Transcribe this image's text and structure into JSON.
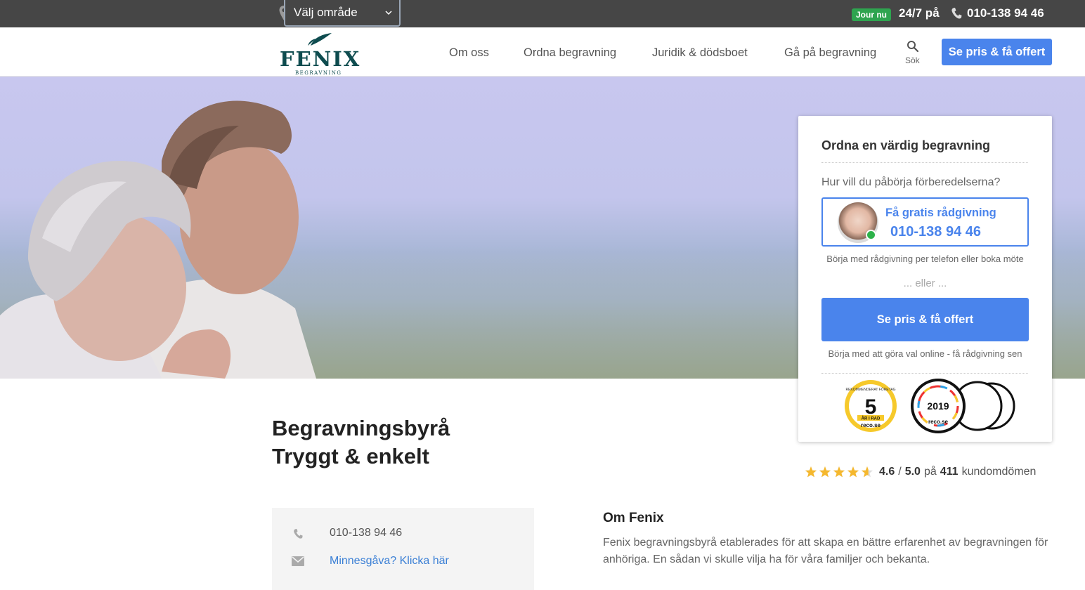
{
  "topbar": {
    "region_label": "Välj område",
    "jour_badge": "Jour nu",
    "hours": "24/7 på",
    "phone": "010-138 94 46"
  },
  "header": {
    "logo_text": "FENIX",
    "logo_subtext": "BEGRAVNING",
    "nav": [
      "Om oss",
      "Ordna begravning",
      "Juridik & dödsboet",
      "Gå på begravning"
    ],
    "search_label": "Sök",
    "cta": "Se pris & få offert"
  },
  "card": {
    "title": "Ordna en värdig begravning",
    "question": "Hur vill du påbörja förberedelserna?",
    "advice_label": "Få gratis rådgivning",
    "advice_phone": "010-138 94 46",
    "note_phone": "Börja med rådgivning per telefon eller boka möte",
    "or": "... eller ...",
    "cta": "Se pris & få offert",
    "note_online": "Börja med att göra val online - få rådgivning sen",
    "badge_years": "5",
    "badge_years_ribbon": "ÅR I RAD",
    "badge_years_ring": "REKOMMENDERAT FÖRETAG",
    "badge_year": "2019",
    "badge_brand": "reco.se"
  },
  "main": {
    "heading_line1": "Begravningsbyrå",
    "heading_line2": "Tryggt & enkelt",
    "rating_value": "4.6",
    "rating_sep": "/",
    "rating_max": "5.0",
    "rating_pa": "på",
    "rating_count": "411",
    "rating_suffix": "kundomdömen",
    "stars_fraction": 0.92
  },
  "contact": {
    "phone": "010-138 94 46",
    "memorial_link": "Minnesgåva? Klicka här"
  },
  "about": {
    "title": "Om Fenix",
    "text": "Fenix begravningsbyrå etablerades för att skapa en bättre erfarenhet av begravningen för anhöriga. En sådan vi skulle vilja ha för våra familjer och bekanta."
  },
  "colors": {
    "topbar_bg": "#464646",
    "accent_blue": "#4a84ec",
    "brand_teal": "#0e4c4f",
    "jour_green": "#2ea44f",
    "star_gold": "#f5b82e"
  }
}
